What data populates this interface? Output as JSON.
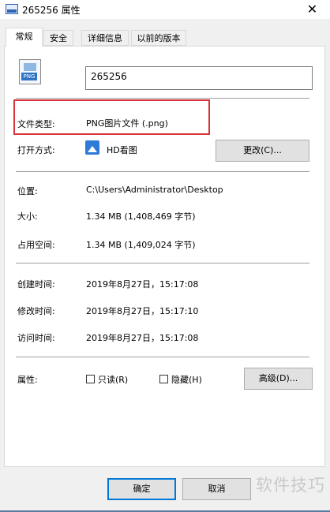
{
  "window": {
    "title": "265256 属性",
    "close_glyph": "✕"
  },
  "tabs": [
    {
      "label": "常规",
      "active": true
    },
    {
      "label": "安全",
      "active": false
    },
    {
      "label": "详细信息",
      "active": false
    },
    {
      "label": "以前的版本",
      "active": false
    }
  ],
  "general": {
    "file_badge": "PNG",
    "file_name": "265256",
    "file_type_label": "文件类型:",
    "file_type_value": "PNG图片文件 (.png)",
    "open_with_label": "打开方式:",
    "open_with_value": "HD看图",
    "change_button": "更改(C)...",
    "location_label": "位置:",
    "location_value": "C:\\Users\\Administrator\\Desktop",
    "size_label": "大小:",
    "size_value": "1.34 MB (1,408,469 字节)",
    "size_on_disk_label": "占用空间:",
    "size_on_disk_value": "1.34 MB (1,409,024 字节)",
    "created_label": "创建时间:",
    "created_value": "2019年8月27日，15:17:08",
    "modified_label": "修改时间:",
    "modified_value": "2019年8月27日，15:17:10",
    "accessed_label": "访问时间:",
    "accessed_value": "2019年8月27日，15:17:08",
    "attributes_label": "属性:",
    "readonly_label": "只读(R)",
    "readonly_checked": false,
    "hidden_label": "隐藏(H)",
    "hidden_checked": false,
    "advanced_button": "高级(D)..."
  },
  "footer": {
    "ok_button": "确定",
    "cancel_button": "取消"
  },
  "watermark": "软件技巧",
  "colors": {
    "highlight_border": "#d9343a",
    "accent": "#0078d7"
  }
}
